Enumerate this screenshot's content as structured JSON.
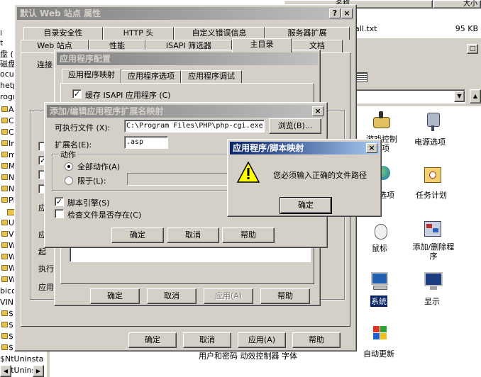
{
  "explorer": {
    "header_name": "名称",
    "header_size": "大小",
    "file_name": "all.txt",
    "file_size": "95 KB",
    "tree_items": [
      "i",
      "t",
      "盘 (",
      "磁盘",
      "ocum",
      "hetpu",
      "rogr",
      "Ac",
      "Co",
      "Co",
      "Inf",
      "mi",
      "My",
      "Ne",
      "Ne",
      "Ou",
      "Ph",
      "",
      "Un",
      "VM",
      "Wi",
      "Wi",
      "Wi",
      "Wi",
      "bicon",
      "VINNT",
      "$N",
      "$N",
      "$N",
      "$N",
      "$NtUninstal",
      "$NtUninstal"
    ],
    "cp_items": [
      {
        "label": "游戏控制\n选项"
      },
      {
        "label": "电源选项"
      },
      {
        "label": "选项"
      },
      {
        "label": "任务计划"
      },
      {
        "label": "鼠标"
      },
      {
        "label": "添加/删除程\n序"
      },
      {
        "label": "系统"
      },
      {
        "label": "显示"
      },
      {
        "label": "自动更新"
      }
    ],
    "bottom_cut": "用户和密码    动效控制器         字体"
  },
  "props_dialog": {
    "title": "默认 Web 站点 属性",
    "tabs_row1": [
      "目录安全性",
      "HTTP 头",
      "自定义错误信息",
      "服务器扩展"
    ],
    "tabs_row2": [
      "Web 站点",
      "性能",
      "ISAPI 筛选器",
      "主目录",
      "文档"
    ],
    "behind_labels": [
      "连接",
      "应",
      "应",
      "起",
      "执行",
      "应用"
    ],
    "ok": "确定",
    "cancel": "取消",
    "apply": "应用(A)",
    "help": "帮助"
  },
  "appconfig_dialog": {
    "title": "应用程序配置",
    "tabs": [
      "应用程序映射",
      "应用程序选项",
      "应用程序调试"
    ],
    "cache_isapi": "缓存 ISAPI 应用程序 (C)",
    "ok": "确定",
    "cancel": "取消",
    "apply": "应用(A)",
    "help": "帮助"
  },
  "mapping_dialog": {
    "title": "添加/编辑应用程序扩展名映射",
    "exe_label": "可执行文件 (X):",
    "exe_value": "C:\\Program Files\\PHP\\php-cgi.exe",
    "browse": "浏览(B)...",
    "ext_label": "扩展名(E):",
    "ext_value": ".asp",
    "action_group": "动作",
    "all_actions": "全部动作(A)",
    "limit_to": "限于(L):",
    "script_engine": "脚本引擎(S)",
    "check_file": "检查文件是否存在(C)",
    "ok": "确定",
    "cancel": "取消",
    "help": "帮助"
  },
  "alert": {
    "title": "应用程序/脚本映射",
    "message": "您必须输入正确的文件路径",
    "ok": "确定"
  },
  "colors": {
    "title_active": "#0a246a",
    "face": "#d4d0c8"
  }
}
